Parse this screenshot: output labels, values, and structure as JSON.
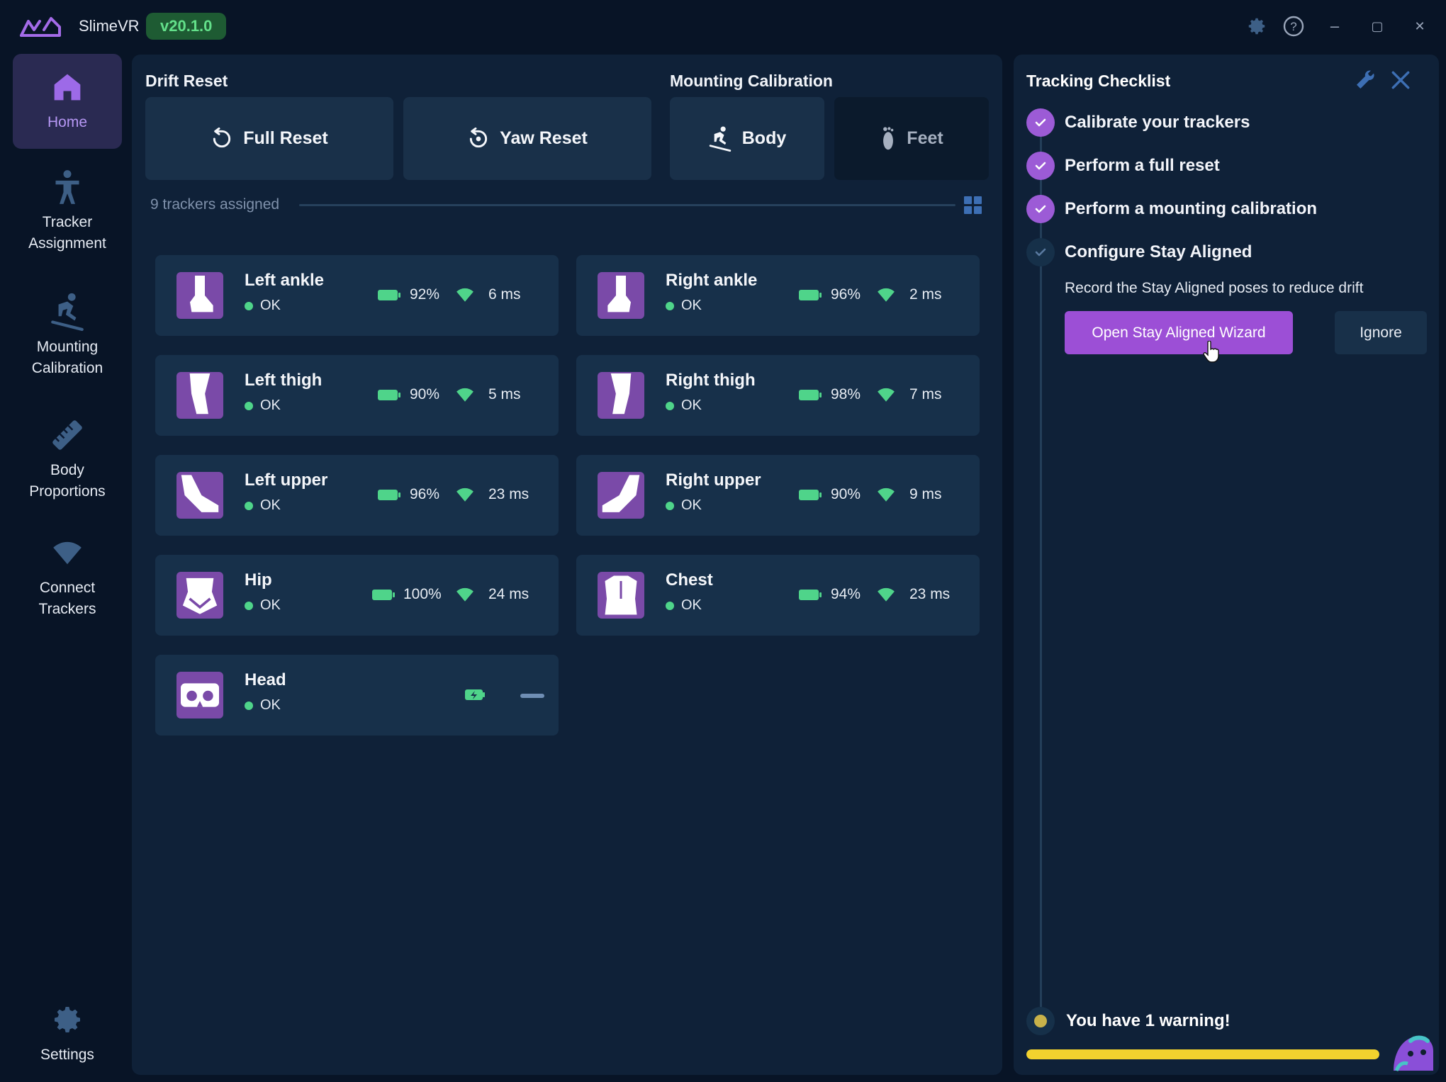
{
  "app": {
    "name": "SlimeVR",
    "version": "v20.1.0"
  },
  "window_controls": {
    "minimize": "–",
    "maximize": "▢",
    "close": "✕"
  },
  "sidebar": {
    "items": [
      {
        "label": "Home",
        "icon": "home-icon",
        "active": true
      },
      {
        "label": "Tracker\nAssignment",
        "icon": "person-icon",
        "active": false
      },
      {
        "label": "Mounting\nCalibration",
        "icon": "skier-icon",
        "active": false
      },
      {
        "label": "Body\nProportions",
        "icon": "ruler-icon",
        "active": false
      },
      {
        "label": "Connect\nTrackers",
        "icon": "wifi-icon",
        "active": false
      }
    ],
    "settings_label": "Settings"
  },
  "main": {
    "drift_reset_title": "Drift Reset",
    "mounting_title": "Mounting Calibration",
    "buttons": {
      "full_reset": "Full Reset",
      "yaw_reset": "Yaw Reset",
      "body": "Body",
      "feet": "Feet"
    },
    "assigned_text": "9 trackers assigned",
    "trackers": [
      {
        "name": "Left ankle",
        "status": "OK",
        "battery": "92%",
        "battery_level": 0.92,
        "ping": "6 ms"
      },
      {
        "name": "Right ankle",
        "status": "OK",
        "battery": "96%",
        "battery_level": 0.96,
        "ping": "2 ms"
      },
      {
        "name": "Left thigh",
        "status": "OK",
        "battery": "90%",
        "battery_level": 0.9,
        "ping": "5 ms"
      },
      {
        "name": "Right thigh",
        "status": "OK",
        "battery": "98%",
        "battery_level": 0.98,
        "ping": "7 ms"
      },
      {
        "name": "Left upper",
        "status": "OK",
        "battery": "96%",
        "battery_level": 0.96,
        "ping": "23 ms"
      },
      {
        "name": "Right upper",
        "status": "OK",
        "battery": "90%",
        "battery_level": 0.9,
        "ping": "9 ms"
      },
      {
        "name": "Hip",
        "status": "OK",
        "battery": "100%",
        "battery_level": 1.0,
        "ping": "24 ms"
      },
      {
        "name": "Chest",
        "status": "OK",
        "battery": "94%",
        "battery_level": 0.94,
        "ping": "23 ms"
      },
      {
        "name": "Head",
        "status": "OK",
        "battery": "",
        "ping": ""
      }
    ]
  },
  "checklist": {
    "title": "Tracking Checklist",
    "steps": [
      {
        "label": "Calibrate your trackers",
        "done": true
      },
      {
        "label": "Perform a full reset",
        "done": true
      },
      {
        "label": "Perform a mounting calibration",
        "done": true
      },
      {
        "label": "Configure Stay Aligned",
        "done": false
      }
    ],
    "step_description": "Record the Stay Aligned poses to reduce drift",
    "primary_button": "Open Stay Aligned Wizard",
    "ignore_button": "Ignore",
    "warning_text": "You have 1 warning!",
    "progress": 1.0
  },
  "colors": {
    "accent": "#9c4fd6",
    "ok_green": "#4fd48a",
    "warning_yellow": "#f2d22e",
    "background": "#081426",
    "panel": "#0f2138"
  }
}
